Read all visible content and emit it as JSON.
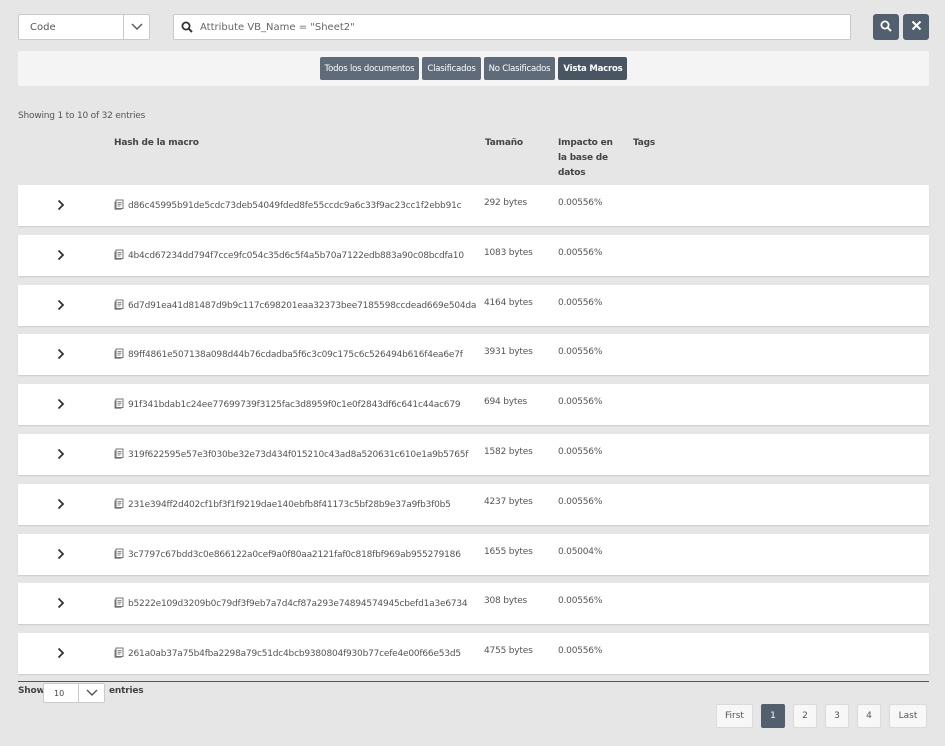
{
  "search": {
    "type_value": "Code",
    "query": "Attribute VB_Name = \"Sheet2\"",
    "search_button": "search-icon",
    "clear_button": "close-icon"
  },
  "filters": [
    {
      "label": "Todos los documentos"
    },
    {
      "label": "Clasificados"
    },
    {
      "label": "No Clasificados"
    },
    {
      "label": "Vista Macros"
    }
  ],
  "table": {
    "info": "Showing 1 to 10 of 32 entries",
    "headers": {
      "hash": "Hash de la macro",
      "size": "Tamaño",
      "impact": "Impacto en la base de datos",
      "tags": "Tags"
    },
    "rows": [
      {
        "hash": "d86c45995b91de5cdc73deb54049fded8fe55ccdc9a6c33f9ac23cc1f2ebb91c",
        "size": "292 bytes",
        "impact": "0.00556%"
      },
      {
        "hash": "4b4cd67234dd794f7cce9fc054c35d6c5f4a5b70a7122edb883a90c08bcdfa10",
        "size": "1083 bytes",
        "impact": "0.00556%"
      },
      {
        "hash": "6d7d91ea41d81487d9b9c117c698201eaa32373bee7185598ccdead669e504da",
        "size": "4164 bytes",
        "impact": "0.00556%"
      },
      {
        "hash": "89ff4861e507138a098d44b76cdadba5f6c3c09c175c6c526494b616f4ea6e7f",
        "size": "3931 bytes",
        "impact": "0.00556%"
      },
      {
        "hash": "91f341bdab1c24ee77699739f3125fac3d8959f0c1e0f2843df6c641c44ac679",
        "size": "694 bytes",
        "impact": "0.00556%"
      },
      {
        "hash": "319f622595e57e3f030be32e73d434f015210c43ad8a520631c610e1a9b5765f",
        "size": "1582 bytes",
        "impact": "0.00556%"
      },
      {
        "hash": "231e394ff2d402cf1bf3f1f9219dae140ebfb8f41173c5bf28b9e37a9fb3f0b5",
        "size": "4237 bytes",
        "impact": "0.00556%"
      },
      {
        "hash": "3c7797c67bdd3c0e866122a0cef9a0f80aa2121faf0c818fbf969ab955279186",
        "size": "1655 bytes",
        "impact": "0.05004%"
      },
      {
        "hash": "b5222e109d3209b0c79df3f9eb7a7d4cf87a293e74894574945cbefd1a3e6734",
        "size": "308 bytes",
        "impact": "0.00556%"
      },
      {
        "hash": "261a0ab37a75b4fba2298a79c51dc4bcb9380804f930b77cefe4e00f66e53d5",
        "size": "4755 bytes",
        "impact": "0.00556%"
      }
    ]
  },
  "footer": {
    "show_label": "Show",
    "page_length": "10",
    "entries_label": "entries",
    "pages": [
      "First",
      "1",
      "2",
      "3",
      "4",
      "Last"
    ],
    "active_page": "1"
  },
  "colors": {
    "accent": "#525f6e",
    "background": "#e6e6e6"
  }
}
